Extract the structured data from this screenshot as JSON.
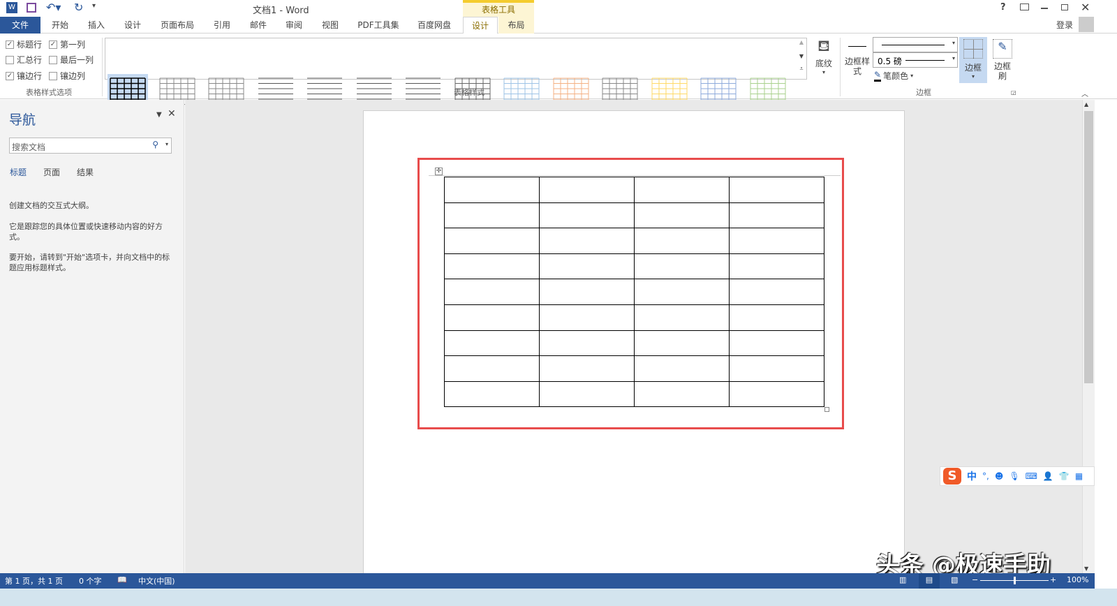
{
  "window": {
    "title": "文档1 - Word",
    "context_tab_group": "表格工具",
    "help": "?",
    "sign_in": "登录"
  },
  "tabs": [
    {
      "label": "文件"
    },
    {
      "label": "开始"
    },
    {
      "label": "插入"
    },
    {
      "label": "设计"
    },
    {
      "label": "页面布局"
    },
    {
      "label": "引用"
    },
    {
      "label": "邮件"
    },
    {
      "label": "审阅"
    },
    {
      "label": "视图"
    },
    {
      "label": "PDF工具集"
    },
    {
      "label": "百度网盘"
    },
    {
      "label": "设计",
      "active": true
    },
    {
      "label": "布局"
    }
  ],
  "ribbon": {
    "style_options": {
      "group_label": "表格样式选项",
      "items": [
        {
          "label": "标题行",
          "checked": true
        },
        {
          "label": "第一列",
          "checked": true
        },
        {
          "label": "汇总行",
          "checked": false
        },
        {
          "label": "最后一列",
          "checked": false
        },
        {
          "label": "镶边行",
          "checked": true
        },
        {
          "label": "镶边列",
          "checked": false
        }
      ]
    },
    "table_styles": {
      "group_label": "表格样式",
      "thumb_colors": [
        "#000000",
        "#888888",
        "#888888",
        "#555555",
        "#555555",
        "#555555",
        "#555555",
        "#666666",
        "#9dc3e6",
        "#f4b183",
        "#888888",
        "#ffd966",
        "#8eaadb",
        "#a9d18e"
      ],
      "selected": 0
    },
    "shading": {
      "label": "底纹"
    },
    "borders": {
      "group_label": "边框",
      "border_styles_label": "边框样式",
      "pen_weight": "0.5 磅",
      "pen_color_label": "笔颜色",
      "borders_label": "边框",
      "border_painter_label": "边框刷"
    }
  },
  "nav": {
    "title": "导航",
    "search_placeholder": "搜索文档",
    "tabs": [
      "标题",
      "页面",
      "结果"
    ],
    "messages": [
      "创建文档的交互式大纲。",
      "它是跟踪您的具体位置或快速移动内容的好方式。",
      "要开始，请转到\"开始\"选项卡，并向文档中的标题应用标题样式。"
    ]
  },
  "table": {
    "rows": 9,
    "cols": 4
  },
  "ime": {
    "label": "中"
  },
  "watermark": "头条 @极速手助",
  "status": {
    "page": "第 1 页，共 1 页",
    "words": "0 个字",
    "language": "中文(中国)",
    "zoom": "100%",
    "zoom_percent": 100
  },
  "accent": "#2b579a",
  "highlight": "#e84c4c"
}
